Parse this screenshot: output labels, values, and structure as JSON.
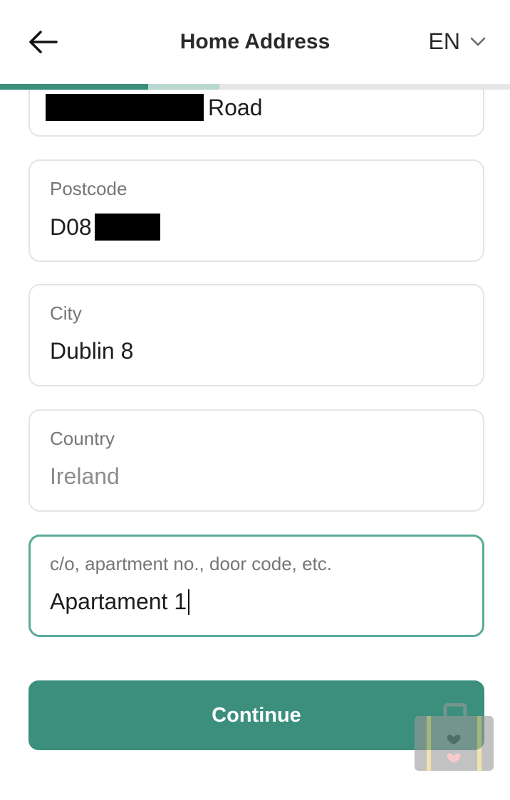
{
  "header": {
    "title": "Home Address",
    "language": "EN",
    "progress_completed": 0.29,
    "progress_current_end": 0.43
  },
  "form": {
    "street": {
      "value_suffix": "Road"
    },
    "postcode": {
      "label": "Postcode",
      "value_prefix": "D08"
    },
    "city": {
      "label": "City",
      "value": "Dublin 8"
    },
    "country": {
      "label": "Country",
      "value": "Ireland"
    },
    "extra": {
      "label": "c/o, apartment no., door code, etc.",
      "value": "Apartament 1"
    }
  },
  "actions": {
    "continue_label": "Continue"
  },
  "colors": {
    "accent": "#3b8f7c",
    "accent_light": "#b9d9d0",
    "focus_border": "#5aab99",
    "field_border": "#e4e4e4"
  },
  "icons": {
    "back": "arrow-left-icon",
    "language_dropdown": "chevron-down-icon",
    "floating_widget": "suitcase-heart-icon"
  }
}
